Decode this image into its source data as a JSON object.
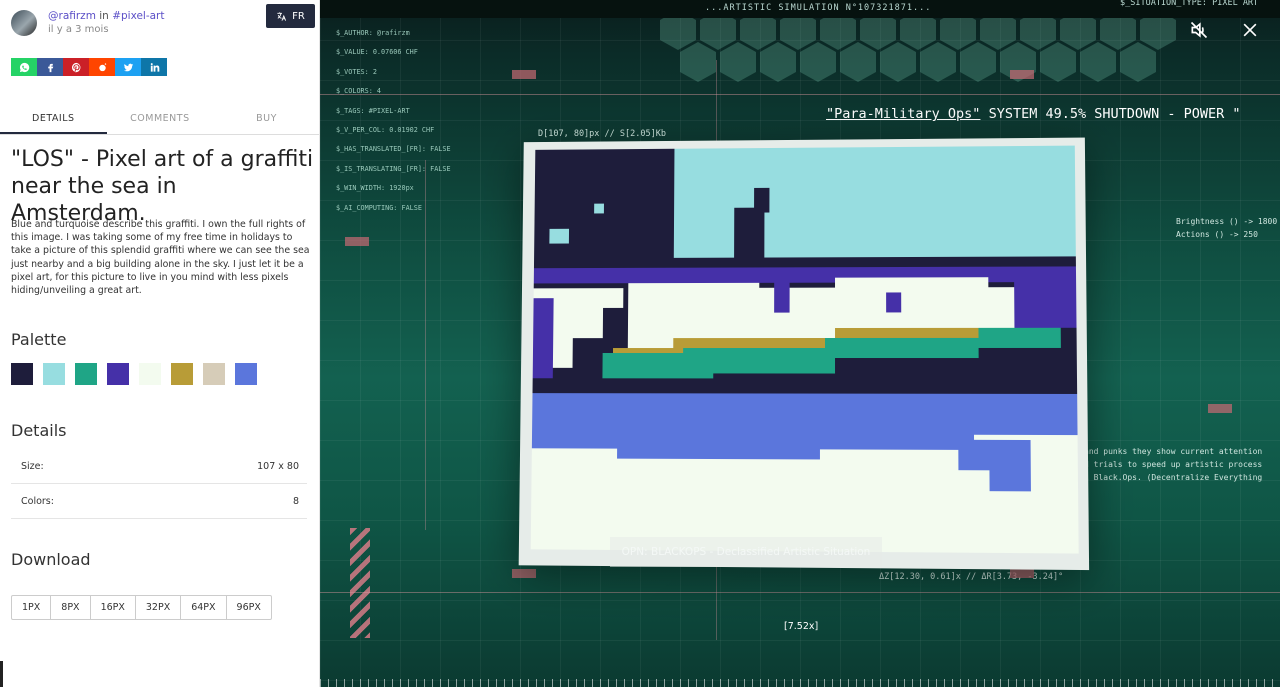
{
  "header": {
    "author": "@rafirzm",
    "in_word": "in",
    "channel": "#pixel-art",
    "time_ago": "il y a 3 mois",
    "lang_label": "FR"
  },
  "share": [
    {
      "name": "whatsapp",
      "color": "#25D366"
    },
    {
      "name": "facebook",
      "color": "#3b5998"
    },
    {
      "name": "pinterest",
      "color": "#cb2027"
    },
    {
      "name": "reddit",
      "color": "#ff4500"
    },
    {
      "name": "twitter",
      "color": "#1da1f2"
    },
    {
      "name": "linkedin",
      "color": "#0e76a8"
    }
  ],
  "tabs": [
    "DETAILS",
    "COMMENTS",
    "BUY"
  ],
  "title": "\"LOS\" - Pixel art of a graffiti near the sea in Amsterdam.",
  "description": "Blue and turquoise describe this graffiti. I own the full rights of this image. I was taking some of my free time in holidays to take a picture of this splendid graffiti where we can see the sea just nearby and a big building alone in the sky. I just let it be a pixel art, for this picture to live in you mind with less pixels hiding/unveiling a great art.",
  "palette_heading": "Palette",
  "palette": [
    "#1e1d3b",
    "#97dde0",
    "#1fa586",
    "#4530a8",
    "#f3fbef",
    "#b89c37",
    "#d6ccb8",
    "#5b76dc"
  ],
  "details_heading": "Details",
  "details": [
    {
      "key": "Size:",
      "value": "107 x 80"
    },
    {
      "key": "Colors:",
      "value": "8"
    }
  ],
  "download_heading": "Download",
  "download_sizes": [
    "1PX",
    "8PX",
    "16PX",
    "32PX",
    "64PX",
    "96PX"
  ],
  "scene": {
    "top_text": "...ARTISTIC SIMULATION N°107321871...",
    "top_text_right": "$_SITUATION_TYPE: PIXEL ART",
    "stats": [
      "$_AUTHOR: @rafirzm",
      "$_VALUE: 0.07606 CHF",
      "$_VOTES: 2",
      "$_COLORS: 4",
      "$_TAGS: #PIXEL-ART",
      "$_V_PER_COL: 0.01902 CHF",
      "$_HAS_TRANSLATED_[FR]: FALSE",
      "$_IS_TRANSLATING_[FR]: FALSE",
      "$_WIN_WIDTH: 1920px",
      "$_AI_COMPUTING: FALSE"
    ],
    "system_line_title": "\"Para-Military Ops\"",
    "system_line_rest": " SYSTEM 49.5% SHUTDOWN - POWER \"",
    "coord_top": "D[107, 80]px // S[2.05]Kb",
    "coord_bottom": "ΔZ[12.30, 0.61]x // ΔR[3.73, -3.24]°",
    "right_lines": [
      "Brightness () -> 1800",
      "Actions () -> 250"
    ],
    "right_lines_2": [
      "and punks they show current attention",
      "d trials to speed up artistic process",
      "l Black.Ops. (Decentralize Everything"
    ],
    "banner": "OPN: BLACKOPS - Declassified Artistic Situation",
    "zoom": "[7.52x]"
  }
}
